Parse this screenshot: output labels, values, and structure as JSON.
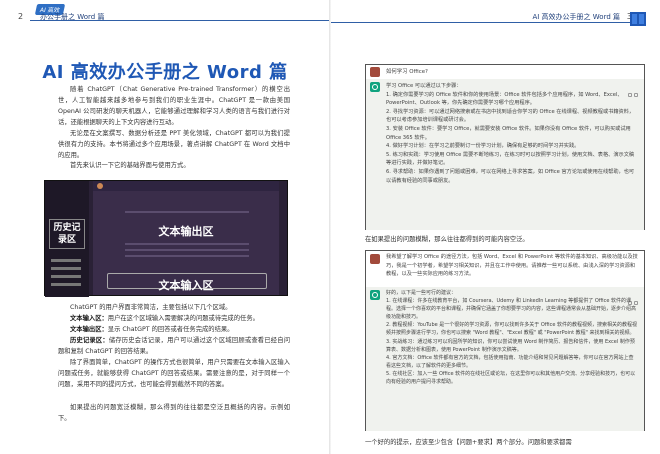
{
  "header": {
    "left_page_number": "2",
    "right_page_number": "3",
    "tag": "AI 高效",
    "left_running_title": "办公手册之 Word 篇",
    "right_running_title": "AI 高效办公手册之 Word 篇"
  },
  "left": {
    "title": "AI 高效办公手册之 Word 篇",
    "intro": "随着 ChatGPT（Chat Generative Pre-trained Transformer）的横空出世，人工智能越来越多地参与到我们的职业生涯中。ChatGPT 是一款由美国 OpenAI 公司研发的聊天机器人，它能够通过理解和学习人类的语言与我们进行对话，还能根据聊天的上下文内容进行互动。",
    "p2": "无论是在文案撰写、数据分析还是 PPT 美化领域，ChatGPT 都可以为我们提供很有力的支持。本书将通过多个应用场景，著点讲解 ChatGPT 在 Word 文档中的应用。",
    "p3": "首先来认识一下它的基础界面与使用方式。",
    "screenshot": {
      "history_label": "历史记录区",
      "output_label": "文本输出区",
      "input_label": "文本输入区"
    },
    "p4": "ChatGPT 的用户界面非常简洁，主要包括以下几个区域。",
    "items": [
      {
        "term": "文本输入区：",
        "desc": "用户在这个区域输入需要解决的问题或待完成的任务。"
      },
      {
        "term": "文本输出区：",
        "desc": "显示 ChatGPT 的回答或者任务完成的结果。"
      },
      {
        "term": "历史记录区：",
        "desc": "储存历史会话记录，用户可以通过这个区域回顾或查看已经自问题和复制 ChatGPT 的回答结果。"
      }
    ],
    "p5": "除了界面简单，ChatGPT 的操作方式也很简单，用户只需要在文本输入区输入问题或任务，就能够获得 ChatGPT 的回答或结果。需要注意的是，对于同样一个问题，采用不同的提问方式，也可能会得到截然不同的答案。",
    "p6": "如果提出的问题宽泛模糊，那么得到的往往都是空泛且概括的内容。示例如下。"
  },
  "right": {
    "chat1": {
      "question": "如何学习 Office?",
      "answer_intro": "学习 Office 可以通过以下步骤：",
      "answer_items": [
        "1. 确定你需要学习的 Office 软件和你的使用场景：Office 软件包括多个应用程序，如 Word、Excel、PowerPoint、Outlook 等，你先确定你需要学习哪个应用程序。",
        "2. 寻找学习资源：可以通过网络搜索或在书店中找到适合你学习的 Office 在线课程、视频教程或书籍资料，也可以考虑参加培训课程或研讨会。",
        "3. 安装 Office 软件：要学习 Office，就需要安装 Office 软件。如果你没有 Office 软件，可以购买或试用 Office 365 软件。",
        "4. 做好学习计划：在学习之前要制订一份学习计划，确保有足够的时间学习并实践。",
        "5. 练习和实践：学习使用 Office 需要不断地练习，在练习时可以按照学习计划，使用文档、表格、演示文稿等进行实践，并做好笔记。",
        "6. 寻求帮助：如果你遇到了问题或困难，可以在网络上寻求答案，如 Office 官方论坛或使用在线帮助，也可以请教有经验的同事或朋友。"
      ]
    },
    "mid_text": "在如果提出的问题模糊，那么往往都得到的可能内容空泛。",
    "chat2": {
      "question": "我希望了解学习 Office 的途径方法，包括 Word、Excel 和 PowerPoint 等软件的基本知识、高级功能以及技巧，我是一个初学者，希望学习相关知识，并且在工作中使用。请推荐一些可以系统、由浅入深的学习资源和教程，以及一些实际应用的练习方法。",
      "answer_intro": "好的，以下是一些可行的建议：",
      "answer_items": [
        "1. 在线课程：许多在线教育平台，如 Coursera、Udemy 和 LinkedIn Learning 等都提供了 Office 软件的课程。选择一个你喜欢的平台和课程，并确保它涵盖了你想要学习的内容，这些课程通常会从基础开始，逐步介绍高级功能和技巧。",
        "2. 教程视频：YouTube 是一个很好的学习资源，你可以找到许多关于 Office 软件的教程视频，搜索相关的教程视频并按照步骤进行学习，你也可以搜索 \"Word 教程\"、\"Excel 教程\" 或 \"PowerPoint 教程\" 来找到相关的视频。",
        "3. 实战练习：通过练习可以巩固所学的知识，你可以尝试使用 Word 制作简历、报告和信件，使用 Excel 制作预算表、数据分析和图表，使用 PowerPoint 制作演示文稿等。",
        "4. 官方文档：Office 软件都有官方的文档，包括使用指南、功能介绍和常见问题解答等，你可以在官方网站上查看这些文档，以了解软件的更多细节。",
        "5. 在线社区：加入一些 Office 软件的在线社区或论坛，在这里你可以和其他用户交流、分享经验和技巧，也可以向有经验的用户提问寻求帮助。"
      ]
    },
    "bottom_text": "一个好的的提示，应该至少包含【问题+要求】两个部分。问题和要求都需"
  }
}
